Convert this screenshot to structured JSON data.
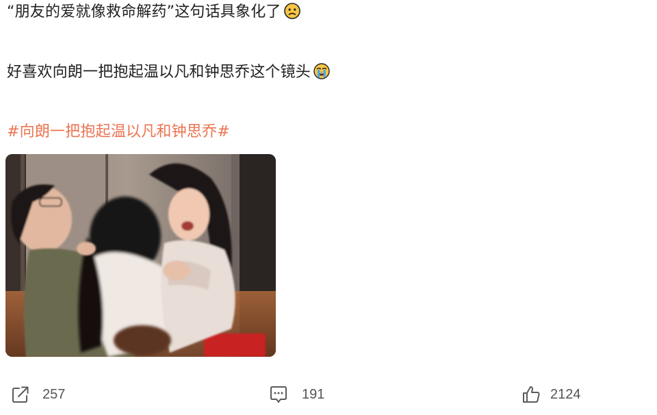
{
  "post": {
    "line1": "“朋友的爱就像救命解药”这句话具象化了",
    "line1_emoji": "sad-face-icon",
    "line2": "好喜欢向朗一把抱起温以凡和钟思乔这个镜头",
    "line2_emoji": "crying-face-icon",
    "hashtag": "#向朗一把抱起温以凡和钟思乔#",
    "hashtag_color": "#eb7350"
  },
  "actions": {
    "repost": {
      "icon": "share-icon",
      "count": "257"
    },
    "comment": {
      "icon": "comment-icon",
      "count": "191"
    },
    "like": {
      "icon": "thumbs-up-icon",
      "count": "2124"
    }
  }
}
